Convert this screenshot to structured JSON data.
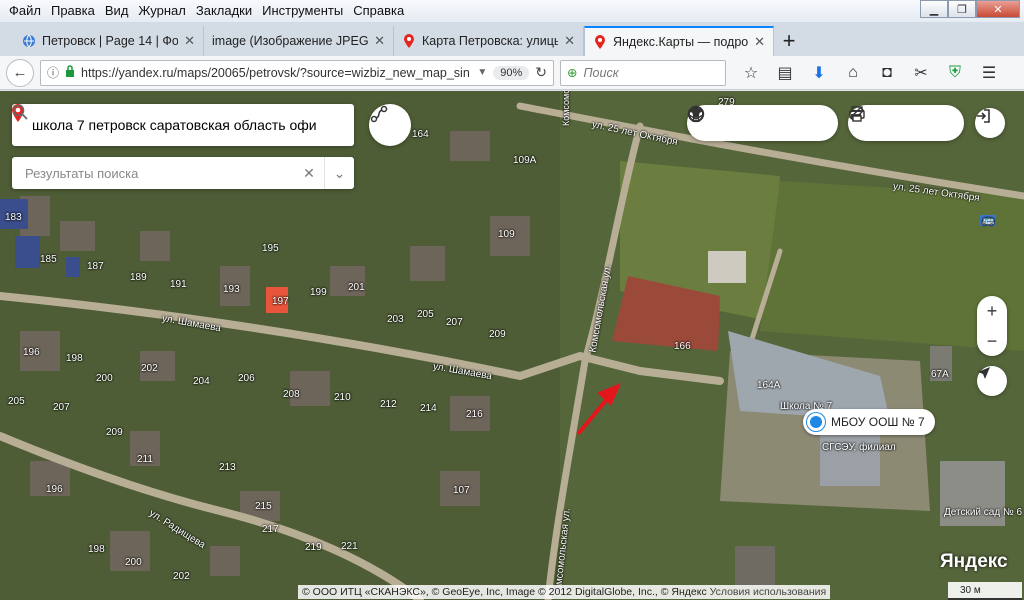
{
  "menu": [
    "Файл",
    "Правка",
    "Вид",
    "Журнал",
    "Закладки",
    "Инструменты",
    "Справка"
  ],
  "tabs": [
    {
      "title": "Петровск | Page 14 | Фото"
    },
    {
      "title": "image (Изображение JPEG, 1"
    },
    {
      "title": "Карта Петровска: улицы"
    },
    {
      "title": "Яндекс.Карты — подробн"
    }
  ],
  "nav": {
    "url": "https://yandex.ru/maps/20065/petrovsk/?source=wizbiz_new_map_sin",
    "zoom": "90%",
    "search_placeholder": "Поиск"
  },
  "map": {
    "search_query": "школа 7 петровск саратовская область офи",
    "results_placeholder": "Результаты поиска",
    "poi_name": "МБОУ ООШ № 7",
    "logo": "Яндекс",
    "scale_label": "30 м",
    "copyright": "© ООО ИТЦ «СКАНЭКС», © GeoEye, Inc, Image © 2012 DigitalGlobe, Inc., © Яндекс",
    "terms_link": "Условия использования",
    "streets": {
      "komsomolskaya_top": "Комсомольская ул.",
      "oktyabrya_1": "ул. 25 лет Октября",
      "oktyabrya_2": "ул. 25 лет Октября",
      "shamaeva_1": "ул. Шамаева",
      "shamaeva_2": "ул. Шамаева",
      "komsomolskaya_mid": "Комсомольская ул.",
      "komsomolskaya_bottom": "Комсомольская ул.",
      "radishcheva": "ул. Радищева"
    },
    "houses": [
      "164",
      "109А",
      "279",
      "183",
      "195",
      "109",
      "185",
      "187",
      "189",
      "191",
      "193",
      "197",
      "199",
      "201",
      "203",
      "205",
      "207",
      "209",
      "196",
      "198",
      "202",
      "200",
      "204",
      "206",
      "208",
      "210",
      "212",
      "214",
      "216",
      "205",
      "207",
      "209",
      "211",
      "213",
      "196",
      "107",
      "215",
      "217",
      "219",
      "221",
      "198",
      "200",
      "202",
      "166",
      "164А",
      "67А"
    ],
    "poi_labels": {
      "school": "Школа № 7",
      "sgseu": "СГСЭУ, филиал",
      "kindergarten": "Детский сад № 6"
    },
    "colors": {
      "poi": "#1e88e5",
      "pin": "#e52620",
      "arrow": "#e3161c"
    }
  }
}
